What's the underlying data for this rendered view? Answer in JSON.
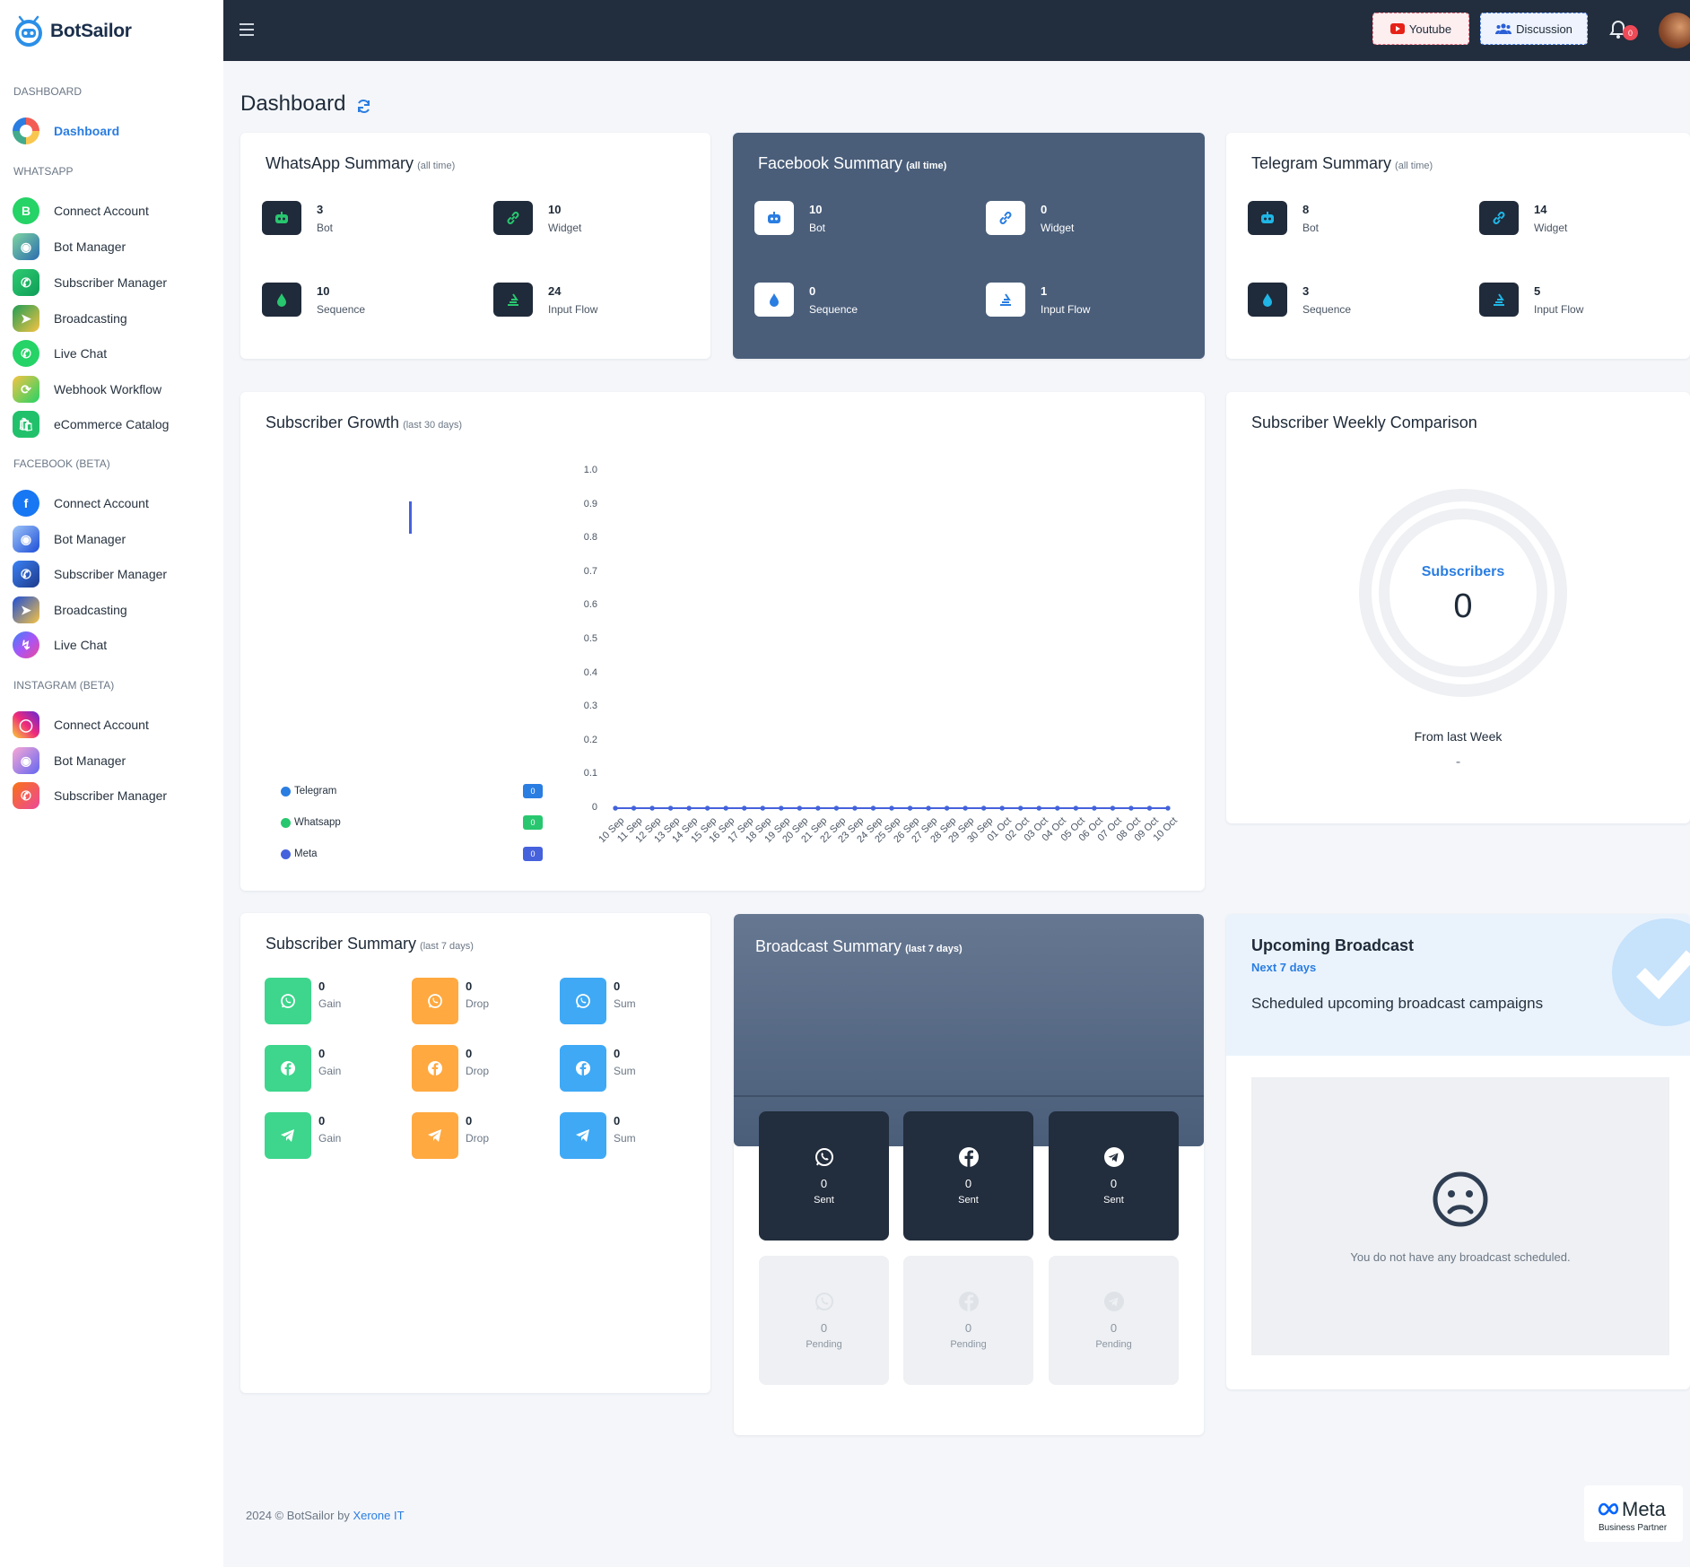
{
  "brand": {
    "name": "BotSailor"
  },
  "sidebar": {
    "sections": [
      {
        "title": "DASHBOARD",
        "items": [
          {
            "label": "Dashboard",
            "icon": "gauge-icon",
            "active": true
          }
        ]
      },
      {
        "title": "WHATSAPP",
        "items": [
          {
            "label": "Connect Account",
            "icon": "whatsapp-business-icon"
          },
          {
            "label": "Bot Manager",
            "icon": "robot-icon"
          },
          {
            "label": "Subscriber Manager",
            "icon": "subscriber-icon"
          },
          {
            "label": "Broadcasting",
            "icon": "broadcast-icon"
          },
          {
            "label": "Live Chat",
            "icon": "whatsapp-icon"
          },
          {
            "label": "Webhook Workflow",
            "icon": "webhook-icon"
          },
          {
            "label": "eCommerce Catalog",
            "icon": "shopping-bag-icon"
          }
        ]
      },
      {
        "title": "FACEBOOK (BETA)",
        "items": [
          {
            "label": "Connect Account",
            "icon": "facebook-icon"
          },
          {
            "label": "Bot Manager",
            "icon": "robot-icon"
          },
          {
            "label": "Subscriber Manager",
            "icon": "subscriber-icon"
          },
          {
            "label": "Broadcasting",
            "icon": "broadcast-icon"
          },
          {
            "label": "Live Chat",
            "icon": "messenger-icon"
          }
        ]
      },
      {
        "title": "INSTAGRAM (BETA)",
        "items": [
          {
            "label": "Connect Account",
            "icon": "instagram-icon"
          },
          {
            "label": "Bot Manager",
            "icon": "robot-icon"
          },
          {
            "label": "Subscriber Manager",
            "icon": "subscriber-icon"
          }
        ]
      }
    ]
  },
  "topbar": {
    "youtube_label": "Youtube",
    "discussion_label": "Discussion",
    "notification_count": "0"
  },
  "page": {
    "title": "Dashboard"
  },
  "whatsapp_summary": {
    "title": "WhatsApp Summary",
    "subtitle": "(all time)",
    "stats": [
      {
        "value": "3",
        "label": "Bot",
        "icon": "robot-icon"
      },
      {
        "value": "10",
        "label": "Widget",
        "icon": "link-icon"
      },
      {
        "value": "10",
        "label": "Sequence",
        "icon": "droplet-icon"
      },
      {
        "value": "24",
        "label": "Input Flow",
        "icon": "stack-icon"
      }
    ]
  },
  "facebook_summary": {
    "title": "Facebook Summary",
    "subtitle": "(all time)",
    "stats": [
      {
        "value": "10",
        "label": "Bot",
        "icon": "robot-icon"
      },
      {
        "value": "0",
        "label": "Widget",
        "icon": "link-icon"
      },
      {
        "value": "0",
        "label": "Sequence",
        "icon": "droplet-icon"
      },
      {
        "value": "1",
        "label": "Input Flow",
        "icon": "stack-icon"
      }
    ]
  },
  "telegram_summary": {
    "title": "Telegram Summary",
    "subtitle": "(all time)",
    "stats": [
      {
        "value": "8",
        "label": "Bot",
        "icon": "robot-icon"
      },
      {
        "value": "14",
        "label": "Widget",
        "icon": "link-icon"
      },
      {
        "value": "3",
        "label": "Sequence",
        "icon": "droplet-icon"
      },
      {
        "value": "5",
        "label": "Input Flow",
        "icon": "stack-icon"
      }
    ]
  },
  "subscriber_growth": {
    "title": "Subscriber Growth",
    "subtitle": "(last 30 days)",
    "legend": [
      {
        "name": "Telegram",
        "count": "0",
        "color": "#2a7de1"
      },
      {
        "name": "Whatsapp",
        "count": "0",
        "color": "#28c76f"
      },
      {
        "name": "Meta",
        "count": "0",
        "color": "#4661dc"
      }
    ]
  },
  "chart_data": {
    "type": "line",
    "title": "Subscriber Growth",
    "x": [
      "10 Sep",
      "11 Sep",
      "12 Sep",
      "13 Sep",
      "14 Sep",
      "15 Sep",
      "16 Sep",
      "17 Sep",
      "18 Sep",
      "19 Sep",
      "20 Sep",
      "21 Sep",
      "22 Sep",
      "23 Sep",
      "24 Sep",
      "25 Sep",
      "26 Sep",
      "27 Sep",
      "28 Sep",
      "29 Sep",
      "30 Sep",
      "01 Oct",
      "02 Oct",
      "03 Oct",
      "04 Oct",
      "05 Oct",
      "06 Oct",
      "07 Oct",
      "08 Oct",
      "09 Oct",
      "10 Oct"
    ],
    "yticks": [
      "1.0",
      "0.9",
      "0.8",
      "0.7",
      "0.6",
      "0.5",
      "0.4",
      "0.3",
      "0.2",
      "0.1",
      "0"
    ],
    "ylim": [
      0,
      1
    ],
    "series": [
      {
        "name": "Telegram",
        "values": [
          0,
          0,
          0,
          0,
          0,
          0,
          0,
          0,
          0,
          0,
          0,
          0,
          0,
          0,
          0,
          0,
          0,
          0,
          0,
          0,
          0,
          0,
          0,
          0,
          0,
          0,
          0,
          0,
          0,
          0,
          0
        ],
        "color": "#2a7de1"
      },
      {
        "name": "Whatsapp",
        "values": [
          0,
          0,
          0,
          0,
          0,
          0,
          0,
          0,
          0,
          0,
          0,
          0,
          0,
          0,
          0,
          0,
          0,
          0,
          0,
          0,
          0,
          0,
          0,
          0,
          0,
          0,
          0,
          0,
          0,
          0,
          0
        ],
        "color": "#28c76f"
      },
      {
        "name": "Meta",
        "values": [
          0,
          0,
          0,
          0,
          0,
          0,
          0,
          0,
          0,
          0,
          0,
          0,
          0,
          0,
          0,
          0,
          0,
          0,
          0,
          0,
          0,
          0,
          0,
          0,
          0,
          0,
          0,
          0,
          0,
          0,
          0
        ],
        "color": "#4661dc"
      }
    ]
  },
  "weekly_comparison": {
    "title": "Subscriber Weekly Comparison",
    "ring_label": "Subscribers",
    "ring_value": "0",
    "from_label": "From last Week",
    "from_value": "-"
  },
  "subscriber_summary": {
    "title": "Subscriber Summary",
    "subtitle": "(last 7 days)",
    "rows": [
      {
        "channel": "whatsapp",
        "icon": "whatsapp-icon",
        "items": [
          {
            "value": "0",
            "label": "Gain"
          },
          {
            "value": "0",
            "label": "Drop"
          },
          {
            "value": "0",
            "label": "Sum"
          }
        ]
      },
      {
        "channel": "facebook",
        "icon": "facebook-icon",
        "items": [
          {
            "value": "0",
            "label": "Gain"
          },
          {
            "value": "0",
            "label": "Drop"
          },
          {
            "value": "0",
            "label": "Sum"
          }
        ]
      },
      {
        "channel": "telegram",
        "icon": "telegram-icon",
        "items": [
          {
            "value": "0",
            "label": "Gain"
          },
          {
            "value": "0",
            "label": "Drop"
          },
          {
            "value": "0",
            "label": "Sum"
          }
        ]
      }
    ],
    "colors": {
      "gain": "#3dd68c",
      "drop": "#ffa940",
      "sum": "#3fa9f5"
    }
  },
  "broadcast_summary": {
    "title": "Broadcast Summary",
    "subtitle": "(last 7 days)",
    "sent": [
      {
        "icon": "whatsapp-icon",
        "value": "0",
        "label": "Sent"
      },
      {
        "icon": "facebook-icon",
        "value": "0",
        "label": "Sent"
      },
      {
        "icon": "telegram-icon",
        "value": "0",
        "label": "Sent"
      }
    ],
    "pending": [
      {
        "icon": "whatsapp-icon",
        "value": "0",
        "label": "Pending"
      },
      {
        "icon": "facebook-icon",
        "value": "0",
        "label": "Pending"
      },
      {
        "icon": "telegram-icon",
        "value": "0",
        "label": "Pending"
      }
    ]
  },
  "upcoming_broadcast": {
    "title": "Upcoming Broadcast",
    "subtitle": "Next 7 days",
    "description": "Scheduled upcoming broadcast campaigns",
    "empty_text": "You do not have any broadcast scheduled."
  },
  "footer": {
    "text": "2024 © BotSailor by ",
    "link": "Xerone IT"
  },
  "meta_badge": {
    "brand": "Meta",
    "tagline": "Business Partner"
  },
  "colors": {
    "topbar": "#222d3d",
    "accent": "#2a7de1",
    "facebook_card": "#4a5e7a"
  }
}
